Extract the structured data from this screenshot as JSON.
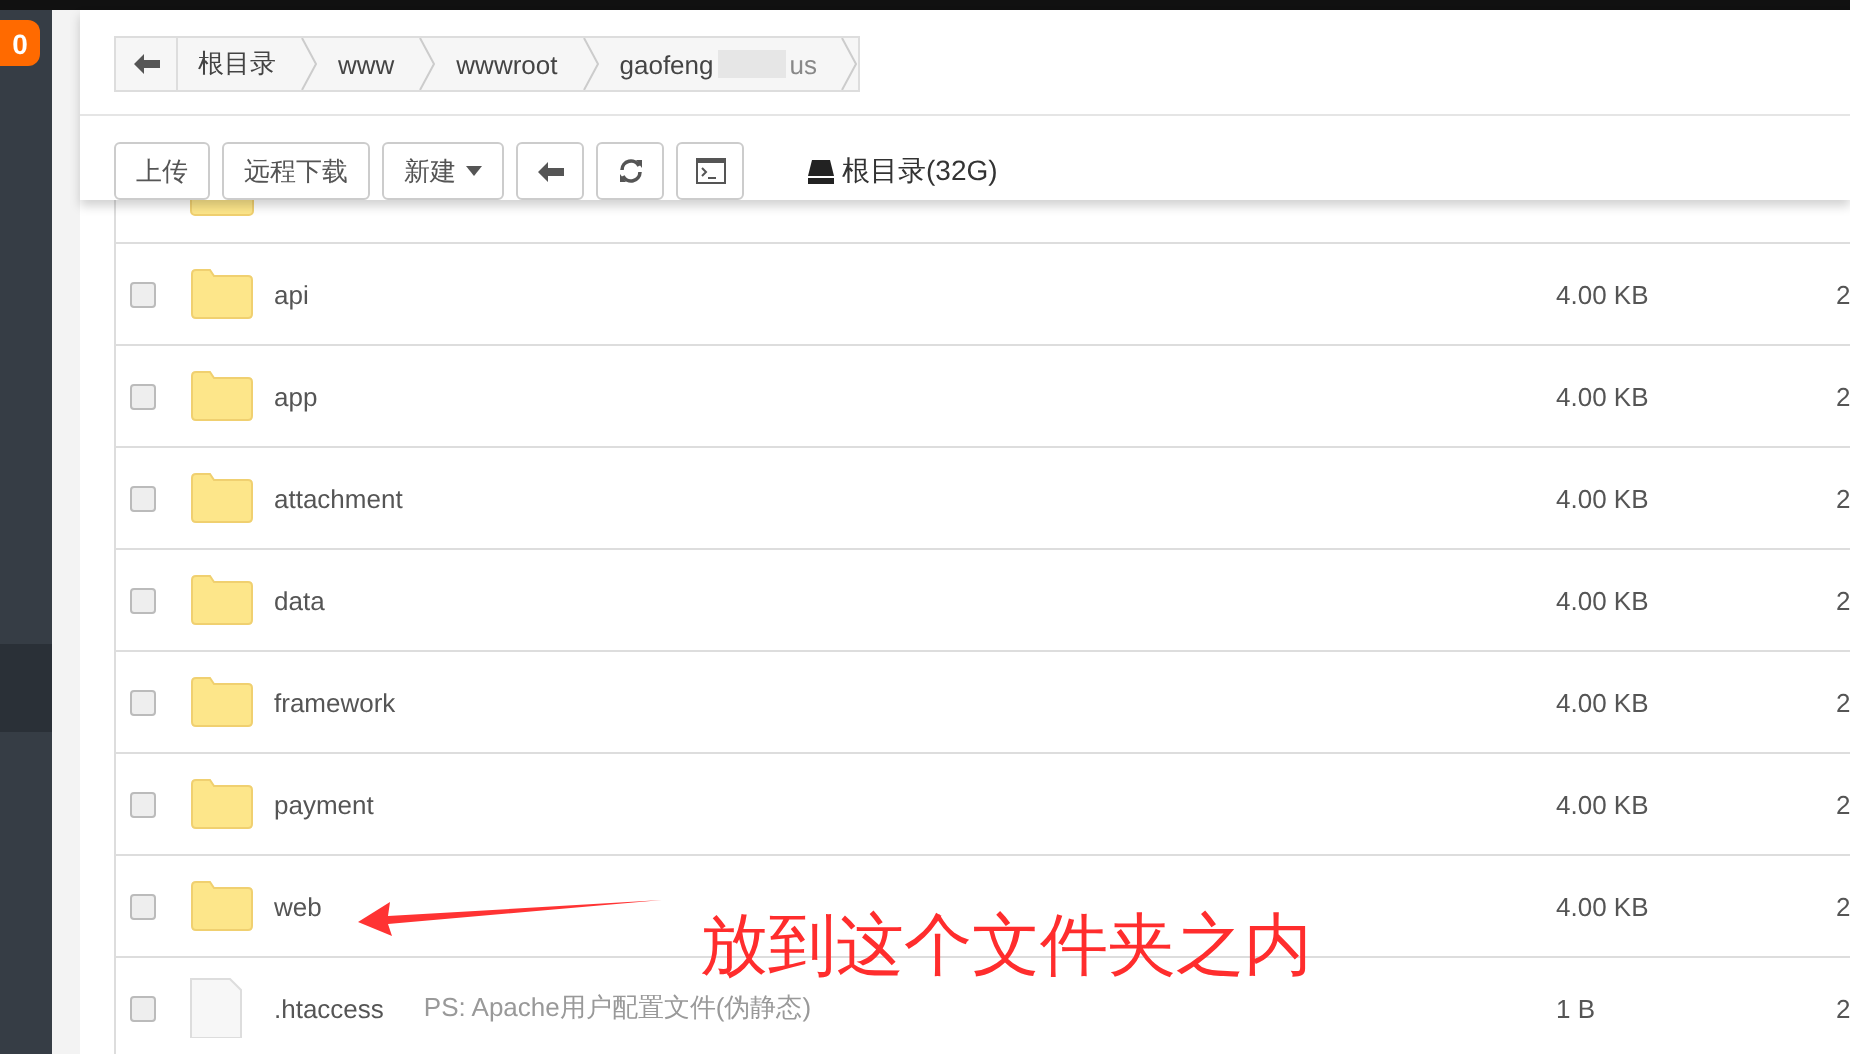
{
  "sidebar": {
    "badge": "0"
  },
  "breadcrumb": {
    "items": [
      {
        "label": "根目录"
      },
      {
        "label": "www"
      },
      {
        "label": "wwwroot"
      },
      {
        "label": "gaofeng",
        "label_end": "us"
      }
    ]
  },
  "toolbar": {
    "buttons": [
      {
        "kind": "text",
        "label": "上传"
      },
      {
        "kind": "text",
        "label": "远程下载"
      },
      {
        "kind": "dropdown",
        "label": "新建"
      },
      {
        "kind": "back"
      },
      {
        "kind": "refresh"
      },
      {
        "kind": "terminal"
      }
    ],
    "disk": "根目录(32G)"
  },
  "rows": [
    {
      "kind": "folder_partial"
    },
    {
      "kind": "folder",
      "name": "api",
      "size": "4.00 KB",
      "column_4": "2",
      "checked": false
    },
    {
      "kind": "folder",
      "name": "app",
      "size": "4.00 KB",
      "column_4": "2",
      "checked": false
    },
    {
      "kind": "folder",
      "name": "attachment",
      "size": "4.00 KB",
      "column_4": "2",
      "checked": false
    },
    {
      "kind": "folder",
      "name": "data",
      "size": "4.00 KB",
      "column_4": "2",
      "checked": false
    },
    {
      "kind": "folder",
      "name": "framework",
      "size": "4.00 KB",
      "column_4": "2",
      "checked": false
    },
    {
      "kind": "folder",
      "name": "payment",
      "size": "4.00 KB",
      "column_4": "2",
      "checked": false
    },
    {
      "kind": "folder",
      "name": "web",
      "size": "4.00 KB",
      "column_4": "2",
      "checked": false
    },
    {
      "kind": "file",
      "name": ".htaccess",
      "note": "PS: Apache用户配置文件(伪静态)",
      "size": "1 B",
      "column_4": "2",
      "checked": false
    }
  ],
  "annotation": {
    "text": "放到这个文件夹之内"
  }
}
